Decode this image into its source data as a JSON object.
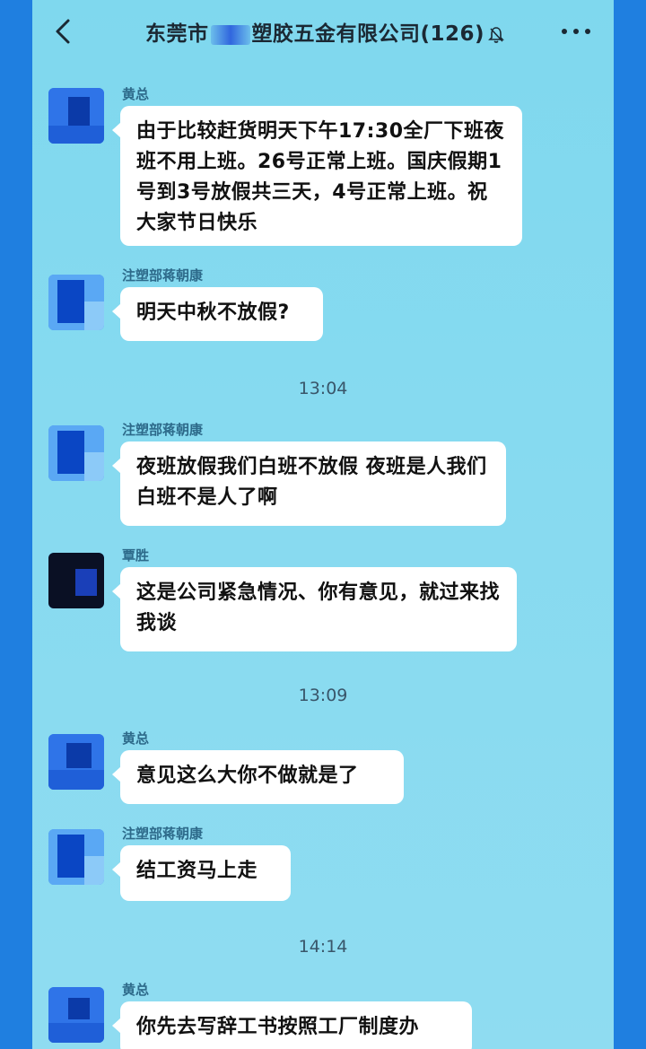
{
  "header": {
    "title_prefix": "东莞市",
    "title_suffix": "塑胶五金有限公司",
    "member_count": "(126)",
    "mute_icon": "bell-mute-icon",
    "back_icon": "chevron-left-icon",
    "more_icon": "more-dots-icon"
  },
  "messages": [
    {
      "sender": "黄总",
      "text": "由于比较赶货明天下午17:30全厂下班夜班不用上班。26号正常上班。国庆假期1号到3号放假共三天，4号正常上班。祝大家节日快乐"
    },
    {
      "sender": "注塑部蒋朝康",
      "text": "明天中秋不放假?"
    },
    {
      "sender": "注塑部蒋朝康",
      "text": "夜班放假我们白班不放假 夜班是人我们白班不是人了啊"
    },
    {
      "sender": "覃胜",
      "text": "这是公司紧急情况、你有意见，就过来找我谈"
    },
    {
      "sender": "黄总",
      "text": "意见这么大你不做就是了"
    },
    {
      "sender": "注塑部蒋朝康",
      "text": "结工资马上走"
    },
    {
      "sender": "黄总",
      "text": "你先去写辞工书按照工厂制度办"
    }
  ],
  "timestamps": [
    "13:04",
    "13:09",
    "14:14"
  ],
  "colors": {
    "background": "#1f7fe0",
    "chat_bg": "#86daf0",
    "bubble": "#ffffff",
    "sender_name": "#2d6a8a"
  }
}
